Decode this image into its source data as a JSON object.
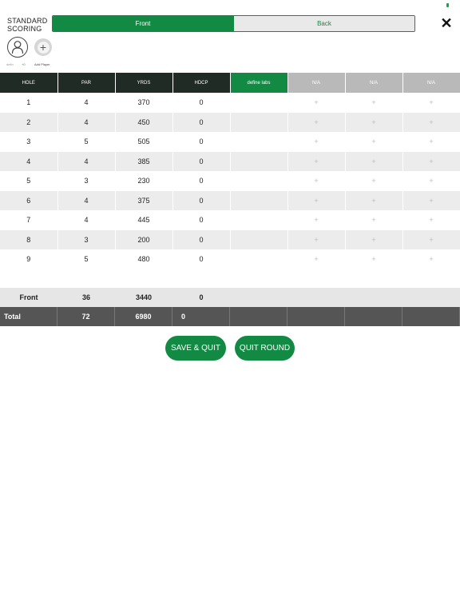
{
  "header": {
    "title_line1": "STANDARD",
    "title_line2": "SCORING",
    "segments": [
      "Front",
      "Back"
    ],
    "close_icon": "close-icon"
  },
  "players": {
    "player_name": "defin",
    "player_hcp": "+0",
    "add_label": "Add Player"
  },
  "table": {
    "columns": [
      "HOLE",
      "PAR",
      "YRDS",
      "HDCP",
      "define labs",
      "N/A",
      "N/A",
      "N/A"
    ],
    "rows": [
      {
        "hole": "1",
        "par": "4",
        "yrds": "370",
        "hdcp": "0"
      },
      {
        "hole": "2",
        "par": "4",
        "yrds": "450",
        "hdcp": "0"
      },
      {
        "hole": "3",
        "par": "5",
        "yrds": "505",
        "hdcp": "0"
      },
      {
        "hole": "4",
        "par": "4",
        "yrds": "385",
        "hdcp": "0"
      },
      {
        "hole": "5",
        "par": "3",
        "yrds": "230",
        "hdcp": "0"
      },
      {
        "hole": "6",
        "par": "4",
        "yrds": "375",
        "hdcp": "0"
      },
      {
        "hole": "7",
        "par": "4",
        "yrds": "445",
        "hdcp": "0"
      },
      {
        "hole": "8",
        "par": "3",
        "yrds": "200",
        "hdcp": "0"
      },
      {
        "hole": "9",
        "par": "5",
        "yrds": "480",
        "hdcp": "0"
      }
    ],
    "add_score_symbol": "+"
  },
  "summary": {
    "front": {
      "label": "Front",
      "par": "36",
      "yrds": "3440",
      "hdcp": "0"
    },
    "total": {
      "label": "Total",
      "par": "72",
      "yrds": "6980",
      "hdcp": "0"
    }
  },
  "actions": {
    "save_label": "SAVE & QUIT",
    "quit_label": "QUIT ROUND"
  },
  "colors": {
    "accent": "#138a44",
    "header_dark": "#1f2b24",
    "total_bg": "#555555"
  }
}
